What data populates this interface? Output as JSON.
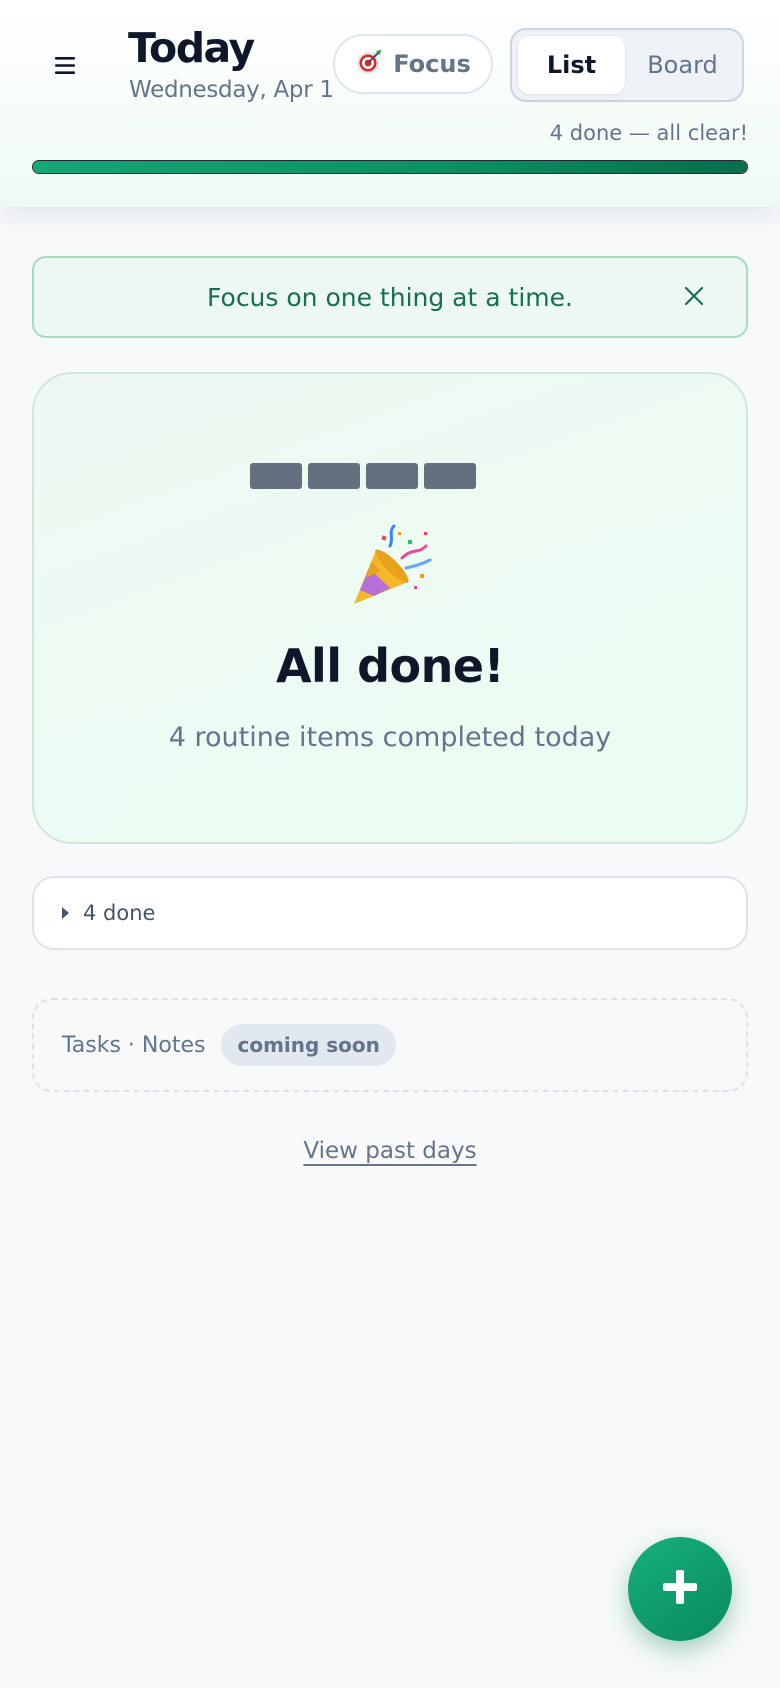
{
  "header": {
    "menu_icon": "hamburger-icon",
    "title": "Today",
    "date": "Wednesday, Apr 1",
    "focus_button": {
      "icon": "target-icon",
      "label": "Focus"
    },
    "view_toggle": {
      "options": [
        "List",
        "Board"
      ],
      "selected": "List"
    },
    "progress": {
      "text": "4 done — all clear!",
      "fraction": 1.0
    }
  },
  "tip": {
    "text": "Focus on one thing at a time.",
    "close_icon": "close-icon"
  },
  "completion": {
    "icon": "party-popper-icon",
    "title": "All done!",
    "subtitle": "4 routine items completed today"
  },
  "done_section": {
    "label": "4 done",
    "icon": "caret-right-icon"
  },
  "coming_soon": {
    "label": "Tasks · Notes",
    "badge": "coming soon"
  },
  "past_link": {
    "label": "View past days"
  },
  "fab": {
    "icon": "plus-icon"
  },
  "colors": {
    "accent": "#13a876",
    "accent_dark": "#0a6d4b",
    "tip_text": "#15704d",
    "muted_text": "#64748b",
    "heading": "#0f172a"
  }
}
